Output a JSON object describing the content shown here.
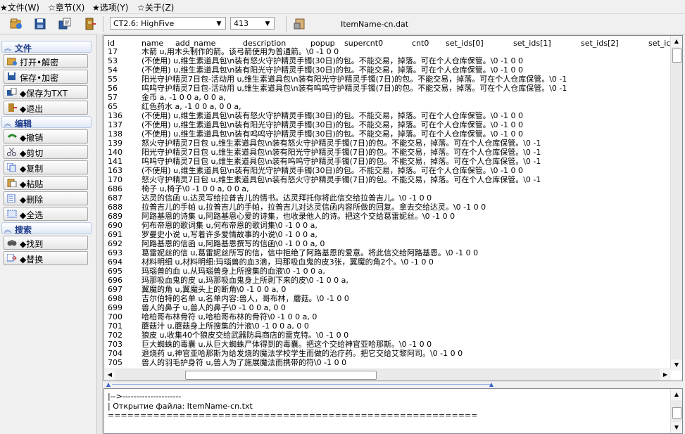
{
  "menu": [
    "★文件(W)",
    "☆章节(X)",
    "★选项(Y)",
    "☆关于(Z)"
  ],
  "toolbar": {
    "version_select": "CT2.6: HighFive",
    "number_select": "413",
    "filename": "ItemName-cn.dat"
  },
  "sidebar": {
    "sections": [
      {
        "title": "文件",
        "items": [
          "打开•解密",
          "保存•加密",
          "◆保存为TXT",
          "◆退出"
        ]
      },
      {
        "title": "编辑",
        "items": [
          "◆撤销",
          "◆剪切",
          "◆复制",
          "◆粘贴",
          "◆删除",
          "◆全选"
        ]
      },
      {
        "title": "搜索",
        "items": [
          "◆找到",
          "◆替换"
        ]
      }
    ]
  },
  "editor": {
    "columns": [
      "id",
      "name",
      "add_name",
      "description",
      "popup",
      "supercnt0",
      "cnt0",
      "set_ids[0]",
      "set_ids[1]",
      "set_ids[2]",
      "set_ic"
    ],
    "rows": [
      {
        "id": "17",
        "text": "木箭                        u,用木头制作的箭。该弓箭使用为普通箭。\\0 -1      0          0"
      },
      {
        "id": "53",
        "text": "(不使用)              u,维生素道具包\\n装有怒火守护精灵手镯(30日)的包。不能交易，掉落。可在个人仓库保管。\\0        -1         0          0"
      },
      {
        "id": "54",
        "text": "(不使用)              u,维生素道具包\\n装有阳光守护精灵手镯(30日)的包。不能交易，掉落。可在个人仓库保管。\\0        -1         0          0"
      },
      {
        "id": "55",
        "text": "阳光守护精灵7日包-活动用              u,维生素道具包\\n装有阳光守护精灵手镯(7日)的包。不能交易，掉落。可在个人仓库保管。\\0        -1"
      },
      {
        "id": "56",
        "text": "呜呜守护精灵7日包-活动用              u,维生素道具包\\n装有呜呜守护精灵手镯(7日)的包。不能交易，掉落。可在个人仓库保管。\\0        -1"
      },
      {
        "id": "57",
        "text": "金币                    a,         -1         0          0                              a,         0          0              a,"
      },
      {
        "id": "65",
        "text": "红色药水                a,         -1         0          0                              a,         0          0              a,"
      },
      {
        "id": "136",
        "text": "(不使用)              u,维生素道具包\\n装有怒火守护精灵手镯(30日)的包。不能交易，掉落。可在个人仓库保管。\\0        -1         0          0"
      },
      {
        "id": "137",
        "text": "(不使用)              u,维生素道具包\\n装有阳光守护精灵手镯(30日)的包。不能交易，掉落。可在个人仓库保管。\\0        -1         0          0"
      },
      {
        "id": "138",
        "text": "(不使用)              u,维生素道具包\\n装有呜呜守护精灵手镯(30日)的包。不能交易，掉落。可在个人仓库保管。\\0        -1         0          0"
      },
      {
        "id": "139",
        "text": "怒火守护精灵7日包              u,维生素道具包\\n装有怒火守护精灵手镯(7日)的包。不能交易，掉落。可在个人仓库保管。\\0        -1"
      },
      {
        "id": "140",
        "text": "阳光守护精灵7日包              u,维生素道具包\\n装有阳光守护精灵手镯(7日)的包。不能交易，掉落。可在个人仓库保管。\\0        -1"
      },
      {
        "id": "141",
        "text": "呜呜守护精灵7日包              u,维生素道具包\\n装有呜呜守护精灵手镯(7日)的包。不能交易，掉落。可在个人仓库保管。\\0        -1"
      },
      {
        "id": "163",
        "text": "(不使用)              u,维生素道具包\\n装有阳光守护精灵手镯(30日)的包。不能交易，掉落。可在个人仓库保管。\\0        -1         0          0"
      },
      {
        "id": "170",
        "text": "怒火守护精灵7日包              u,维生素道具包\\n装有怒火守护精灵手镯(7日)的包。不能交易，掉落。可在个人仓库保管。\\0        -1"
      },
      {
        "id": "686",
        "text": "椅子                    u,椅子\\0 -1      0          0                              a,         0          0              a,"
      },
      {
        "id": "687",
        "text": "达灵的信函                      u,达灵写给拉普吉儿的情书。达灵拜托你将此信交给拉普吉儿。\\0       -1        0          0"
      },
      {
        "id": "688",
        "text": "拉普吉儿的手帕                      u,拉普吉儿的手帕，拉普吉儿对达灵信函内容所做的回复。拿去交给达灵。\\0     -1        0          0"
      },
      {
        "id": "689",
        "text": "阿路基恩的诗集                      u,阿路基恩心爱的诗集，也收录他人的诗。把这个交给葛雷妮丝。\\0    -1        0          0"
      },
      {
        "id": "690",
        "text": "何布帝恩的歌词集                      u,何布帝恩的歌词集\\0      -1        0          0                              a,"
      },
      {
        "id": "691",
        "text": "罗曼史小说                      u,写着许多爱情故事的小说\\0      -1        0          0                              a,"
      },
      {
        "id": "692",
        "text": "阿路基恩的信函                      u,阿路基恩撰写的信函\\0      -1        0          0                        a,         0"
      },
      {
        "id": "693",
        "text": "葛雷妮丝的信                      u,葛雷妮丝所写的信，信中拒绝了阿路基恩的爱意。将此信交给阿路基恩。\\0     -1        0          0"
      },
      {
        "id": "694",
        "text": "材料明细                      u,材料明细:玛瑙兽的血3滴，玛那吸血鬼的皮3张，翼魔的角2个。\\0     -1        0          0"
      },
      {
        "id": "695",
        "text": "玛瑙兽的血                      u,从玛瑙兽身上所搜集的血液\\0      -1        0          0                              a,"
      },
      {
        "id": "696",
        "text": "玛那吸血鬼的皮                      u,玛那吸血鬼身上所剥下来的皮\\0      -1        0          0                              a,"
      },
      {
        "id": "697",
        "text": "翼魔的角                      u,翼魔头上的断角\\0      -1        0          0                        a,         0"
      },
      {
        "id": "698",
        "text": "吉尔伯特的名单                      u,名单内容:兽人，哥布林，蘑菇。\\0      -1        0          0"
      },
      {
        "id": "699",
        "text": "兽人的鼻子                      u,兽人的鼻子\\0   -1      0          0                        a,         0          0"
      },
      {
        "id": "700",
        "text": "哈柏哥布林骨符                      u,哈柏哥布林的骨符\\0      -1        0          0                        a,         0"
      },
      {
        "id": "701",
        "text": "蘑菇汁                u,蘑菇身上所搜集的汁液\\0 -1      0          0                        a,         0          0"
      },
      {
        "id": "702",
        "text": "狼皮                u,收集40个狼皮交给武器防具商店的雷克特。\\0      -1        0          0"
      },
      {
        "id": "703",
        "text": "巨大蜘蛛的毒囊                      u,从巨大蜘蛛尸体得到的毒囊。把这个交给神官亚哈那斯。\\0    -1        0          0"
      },
      {
        "id": "704",
        "text": "退烧药                u,神官亚哈那斯为给发烧的魔法学校学生而做的治疗药。把它交给艾黎阿司。\\0   -1        0          0"
      },
      {
        "id": "705",
        "text": "兽人的羽毛护身符                      u,兽人为了施展魔法而携带的符\\0   -1        0          0"
      }
    ]
  },
  "log": {
    "lines": [
      "|-->---------------------",
      "| Открытие файла: ItemName-cn.txt",
      "========================================================="
    ]
  }
}
